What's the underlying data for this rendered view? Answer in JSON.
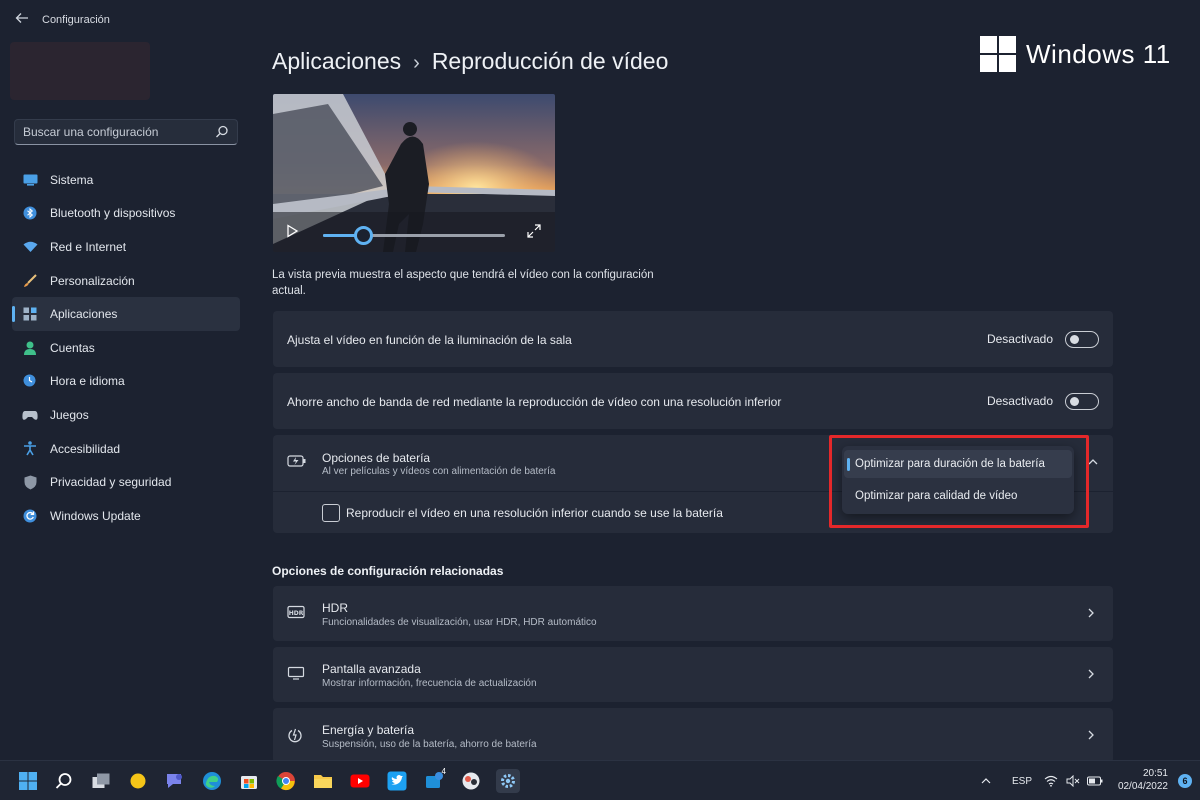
{
  "window": {
    "title": "Configuración",
    "back_icon": "back-arrow-icon"
  },
  "search": {
    "placeholder": "Buscar una configuración"
  },
  "sidebar": {
    "items": [
      {
        "label": "Sistema",
        "icon": "system-icon",
        "active": false
      },
      {
        "label": "Bluetooth y dispositivos",
        "icon": "bluetooth-icon",
        "active": false
      },
      {
        "label": "Red e Internet",
        "icon": "network-icon",
        "active": false
      },
      {
        "label": "Personalización",
        "icon": "brush-icon",
        "active": false
      },
      {
        "label": "Aplicaciones",
        "icon": "apps-icon",
        "active": true
      },
      {
        "label": "Cuentas",
        "icon": "account-icon",
        "active": false
      },
      {
        "label": "Hora e idioma",
        "icon": "globe-clock-icon",
        "active": false
      },
      {
        "label": "Juegos",
        "icon": "gamepad-icon",
        "active": false
      },
      {
        "label": "Accesibilidad",
        "icon": "accessibility-icon",
        "active": false
      },
      {
        "label": "Privacidad y seguridad",
        "icon": "shield-icon",
        "active": false
      },
      {
        "label": "Windows Update",
        "icon": "update-icon",
        "active": false
      }
    ]
  },
  "header": {
    "breadcrumb_parent": "Aplicaciones",
    "breadcrumb_sep": "›",
    "page_title": "Reproducción de vídeo"
  },
  "watermark": {
    "text": "Windows 11"
  },
  "preview": {
    "description": "La vista previa muestra el aspecto que tendrá el vídeo con la configuración actual.",
    "progress": 0.22
  },
  "settings": {
    "lighting": {
      "label": "Ajusta el vídeo en función de la iluminación de la sala",
      "state": "Desactivado"
    },
    "bandwidth": {
      "label": "Ahorre ancho de banda de red mediante la reproducción de vídeo con una resolución inferior",
      "state": "Desactivado"
    },
    "battery": {
      "title": "Opciones de batería",
      "subtitle": "Al ver películas y vídeos con alimentación de batería",
      "checkbox_label": "Reproducir el vídeo en una resolución inferior cuando se use la batería",
      "dropdown_options": [
        "Optimizar para duración de la batería",
        "Optimizar para calidad de vídeo"
      ],
      "selected_index": 0
    }
  },
  "related": {
    "title": "Opciones de configuración relacionadas",
    "items": [
      {
        "title": "HDR",
        "subtitle": "Funcionalidades de visualización, usar HDR, HDR automático",
        "icon": "hdr-icon"
      },
      {
        "title": "Pantalla avanzada",
        "subtitle": "Mostrar información, frecuencia de actualización",
        "icon": "monitor-icon"
      },
      {
        "title": "Energía y batería",
        "subtitle": "Suspensión, uso de la batería, ahorro de batería",
        "icon": "power-icon"
      }
    ]
  },
  "taskbar": {
    "language": "ESP",
    "time": "20:51",
    "date": "02/04/2022",
    "notification_count": "6",
    "store_badge": "4"
  },
  "colors": {
    "accent": "#5fb2f2",
    "highlight": "#e4282a",
    "background": "#1c2230",
    "card": "#262c3a"
  }
}
